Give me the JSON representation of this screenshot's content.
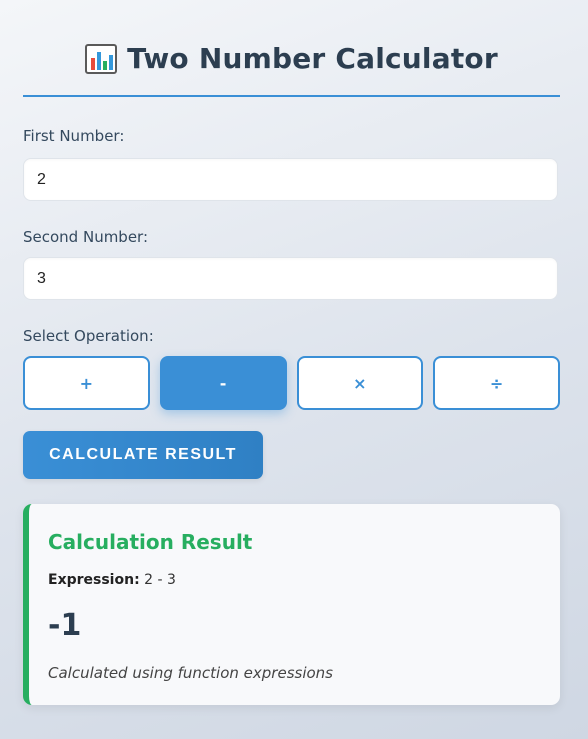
{
  "header": {
    "icon": "bar-chart-icon",
    "title": "Two Number Calculator"
  },
  "form": {
    "first_label": "First Number:",
    "first_value": "2",
    "second_label": "Second Number:",
    "second_value": "3",
    "operation_label": "Select Operation:",
    "operations": [
      {
        "label": "+",
        "active": false
      },
      {
        "label": "-",
        "active": true
      },
      {
        "label": "×",
        "active": false
      },
      {
        "label": "÷",
        "active": false
      }
    ],
    "calculate_label": "CALCULATE RESULT"
  },
  "result": {
    "title": "Calculation Result",
    "expression_label": "Expression:",
    "expression_value": "2 - 3",
    "value": "-1",
    "note": "Calculated using function expressions"
  },
  "colors": {
    "accent": "#3a8fd6",
    "success": "#27ae60",
    "text": "#2c3e50"
  }
}
